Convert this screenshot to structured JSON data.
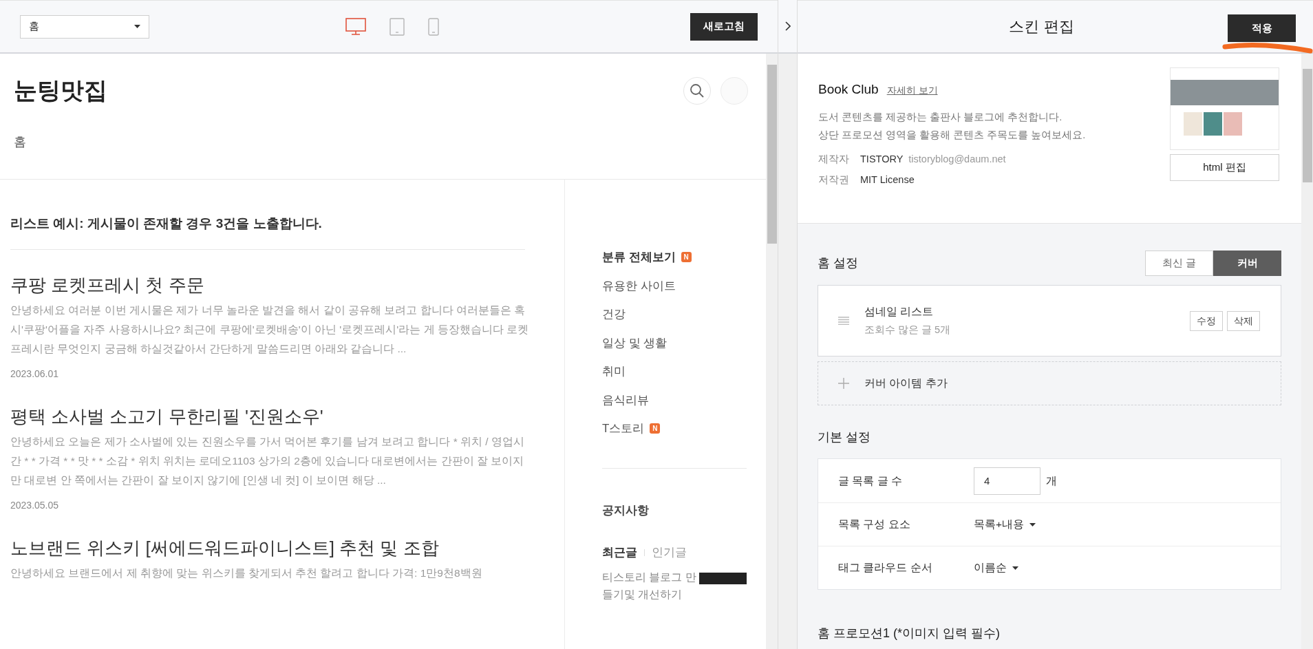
{
  "toolbar": {
    "page_select": "홈",
    "devices": [
      {
        "kind": "desktop",
        "selected": true
      },
      {
        "kind": "tablet",
        "selected": false
      },
      {
        "kind": "mobile",
        "selected": false
      }
    ],
    "refresh_button": "새로고침"
  },
  "blog": {
    "title": "눈팅맛집",
    "nav": [
      "홈"
    ],
    "list_heading": "리스트 예시: 게시물이 존재할 경우 3건을 노출합니다.",
    "posts": [
      {
        "title": "쿠팡 로켓프레시 첫 주문",
        "excerpt": "안녕하세요 여러분 이번 게시물은 제가 너무 놀라운 발견을 해서 같이 공유해 보려고 합니다 여러분들은 혹시'쿠팡'어플을 자주 사용하시나요? 최근에 쿠팡에'로켓배송'이 아닌 '로켓프레시'라는 게 등장했습니다 로켓프레시란 무엇인지 궁금해 하실것같아서 간단하게 말씀드리면 아래와 같습니다 ...",
        "date": "2023.06.01"
      },
      {
        "title": "평택 소사벌 소고기 무한리필 '진원소우'",
        "excerpt": "안녕하세요 오늘은 제가 소사벌에 있는 진원소우를 가서 먹어본 후기를 남겨 보려고 합니다 * 위치 / 영업시간 * * 가격 * * 맛 * * 소감 * 위치 위치는 로데오1103 상가의 2층에 있습니다 대로변에서는 간판이 잘 보이지만 대로변 안 쪽에서는 간판이 잘 보이지 않기에 [인생 네 컷] 이 보이면 해당 ...",
        "date": "2023.05.05"
      },
      {
        "title": "노브랜드 위스키 [써에드워드파이니스트] 추천 및 조합",
        "excerpt": "안녕하세요 브랜드에서 제 취향에 맞는 위스키를 찾게되서 추천 할려고 합니다 가격: 1만9천8백원"
      }
    ],
    "sidebar": {
      "categories": [
        {
          "label": "분류 전체보기",
          "badge": "N"
        },
        {
          "label": "유용한 사이트"
        },
        {
          "label": "건강"
        },
        {
          "label": "일상 및 생활"
        },
        {
          "label": "취미"
        },
        {
          "label": "음식리뷰"
        },
        {
          "label": "T스토리",
          "badge": "N"
        }
      ],
      "notice_heading": "공지사항",
      "tabs": [
        {
          "label": "최근글",
          "selected": true
        },
        {
          "label": "인기글",
          "selected": false
        }
      ],
      "recent_posts": [
        {
          "title": "티스토리 블로그 만들기및 개선하기"
        }
      ]
    }
  },
  "editor": {
    "title": "스킨 편집",
    "apply_button": "적용",
    "skin": {
      "name": "Book Club",
      "details_link": "자세히 보기",
      "description": [
        "도서 콘텐츠를 제공하는 출판사 블로그에 추천합니다.",
        "상단 프로모션 영역을 활용해 콘텐츠 주목도를 높여보세요."
      ],
      "meta": [
        {
          "label": "제작자",
          "value": "TISTORY",
          "extra": "tistoryblog@daum.net"
        },
        {
          "label": "저작권",
          "value": "MIT License"
        }
      ],
      "html_edit_button": "html 편집"
    },
    "home_settings": {
      "heading": "홈 설정",
      "modes": [
        {
          "label": "최신 글",
          "selected": false
        },
        {
          "label": "커버",
          "selected": true
        }
      ],
      "cover_items": [
        {
          "title": "섬네일 리스트",
          "subtitle": "조회수 많은 글 5개",
          "actions": [
            "수정",
            "삭제"
          ]
        }
      ],
      "add_item": "커버 아이템 추가"
    },
    "basic_settings": {
      "heading": "기본 설정",
      "rows": [
        {
          "kind": "input",
          "label": "글 목록 글 수",
          "value": "4",
          "unit": "개"
        },
        {
          "kind": "select",
          "label": "목록 구성 요소",
          "value": "목록+내용"
        },
        {
          "kind": "select",
          "label": "태그 클라우드 순서",
          "value": "이름순"
        }
      ]
    },
    "next_section_heading": "홈 프로모션1 (*이미지 입력 필수)"
  }
}
